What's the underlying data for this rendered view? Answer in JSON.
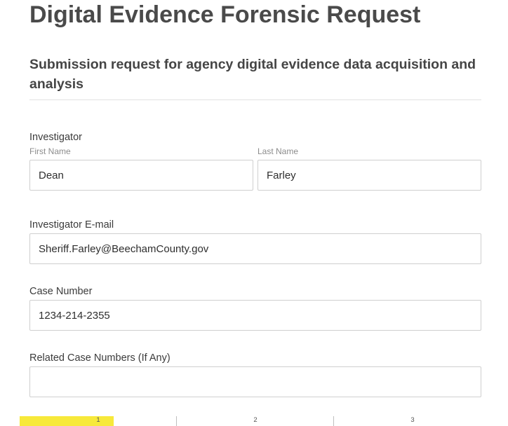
{
  "form": {
    "title": "Digital Evidence Forensic Request",
    "subtitle": "Submission request for agency digital evidence data acquisition and analysis",
    "investigator": {
      "label": "Investigator",
      "first_name_label": "First Name",
      "first_name_value": "Dean",
      "last_name_label": "Last Name",
      "last_name_value": "Farley"
    },
    "email": {
      "label": "Investigator E-mail",
      "value": "Sheriff.Farley@BeechamCounty.gov"
    },
    "case_number": {
      "label": "Case Number",
      "value": "1234-214-2355"
    },
    "related_cases": {
      "label": "Related Case Numbers (If Any)",
      "value": ""
    }
  },
  "progress": {
    "steps": [
      "1",
      "2",
      "3"
    ],
    "current_step": 1,
    "fill_fraction": 0.2,
    "fill_color": "#f7e93a"
  }
}
